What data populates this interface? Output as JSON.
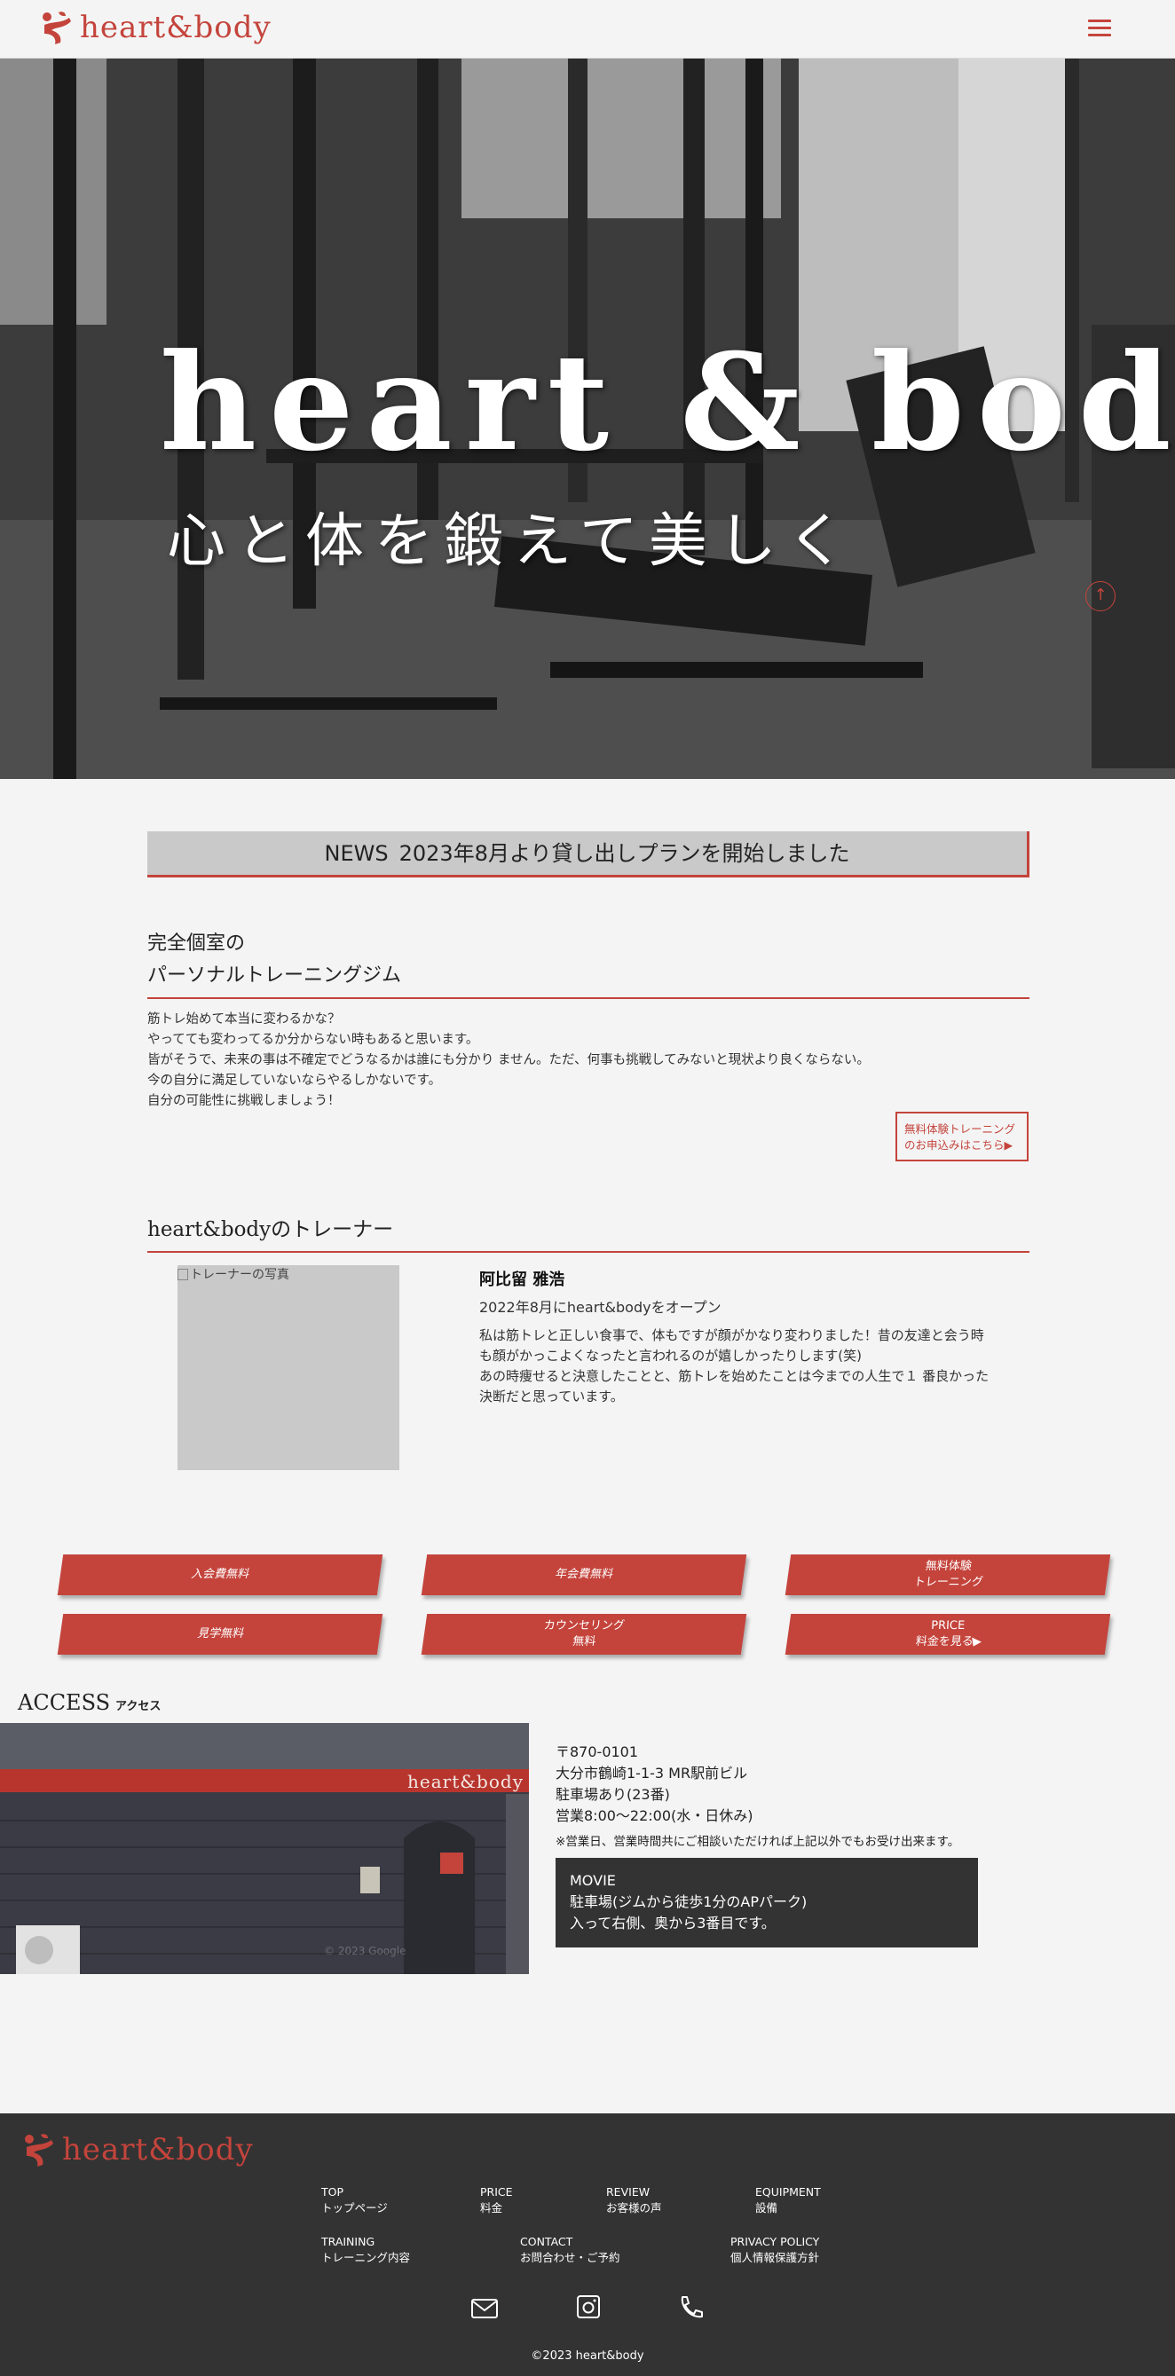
{
  "header": {
    "logo_text": "heart&body"
  },
  "hero": {
    "title": "heart & body",
    "subtitle": "心と体を鍛えて美しく"
  },
  "news": {
    "label": "NEWS",
    "text": "2023年8月より貸し出しプランを開始しました"
  },
  "intro": {
    "heading_line1": "完全個室の",
    "heading_line2": "パーソナルトレーニングジム",
    "body": [
      "筋トレ始めて本当に変わるかな？",
      "やってても変わってるか分からない時もあると思います。",
      "皆がそうで、未来の事は不確定でどうなるかは誰にも分かり ません。ただ、何事も挑戦してみないと現状より良くならない。",
      "今の自分に満足していないならやるしかないです。",
      "自分の可能性に挑戦しましょう！"
    ],
    "trial_line1": "無料体験トレーニング",
    "trial_line2": "のお申込みはこちら▶"
  },
  "trainer": {
    "heading": "heart&bodyのトレーナー",
    "photo_alt": "トレーナーの写真",
    "name": "阿比留 雅浩",
    "opened": "2022年8月にheart&bodyをオープン",
    "bio": [
      "私は筋トレと正しい食事で、体もですが顔がかなり変わりました！昔の友達と会う時",
      "も顔がかっこよくなったと言われるのが嬉しかったりします(笑)",
      "あの時痩せると決意したことと、筋トレを始めたことは今までの人生で１ 番良かった",
      "決断だと思っています。"
    ]
  },
  "buttons": {
    "b1": "入会費無料",
    "b2": "年会費無料",
    "b3_line1": "無料体験",
    "b3_line2": "トレーニング",
    "b4": "見学無料",
    "b5_line1": "カウンセリング",
    "b5_line2": "無料",
    "b6_line1": "PRICE",
    "b6_line2": "料金を見る▶"
  },
  "access": {
    "title": "ACCESS",
    "title_ja": "アクセス",
    "sign": "heart&body",
    "watermark": "© 2023 Google",
    "postal": "〒870-0101",
    "address": "大分市鶴崎1-1-3 MR駅前ビル",
    "parking": "駐車場あり(23番)",
    "hours": "営業8:00～22:00(水・日休み)",
    "note": "※営業日、営業時間共にご相談いただければ上記以外でもお受け出来ます。",
    "movie_label": "MOVIE",
    "movie_line1": "駐車場(ジムから徒歩1分のAPパーク)",
    "movie_line2": "入って右側、奥から3番目です。"
  },
  "footer": {
    "logo_text": "heart&body",
    "nav": {
      "top_en": "TOP",
      "top_ja": "トップページ",
      "price_en": "PRICE",
      "price_ja": "料金",
      "review_en": "REVIEW",
      "review_ja": "お客様の声",
      "equipment_en": "EQUIPMENT",
      "equipment_ja": "設備",
      "training_en": "TRAINING",
      "training_ja": "トレーニング内容",
      "contact_en": "CONTACT",
      "contact_ja": "お問合わせ・ご予約",
      "privacy_en": "PRIVACY POLICY",
      "privacy_ja": "個人情報保護方針"
    },
    "icons": [
      "mail-icon",
      "instagram-icon",
      "phone-icon"
    ],
    "copyright": "©2023 heart&body"
  },
  "colors": {
    "accent": "#c4443c",
    "footer_bg": "#333333",
    "page_bg": "#f4f4f4"
  }
}
